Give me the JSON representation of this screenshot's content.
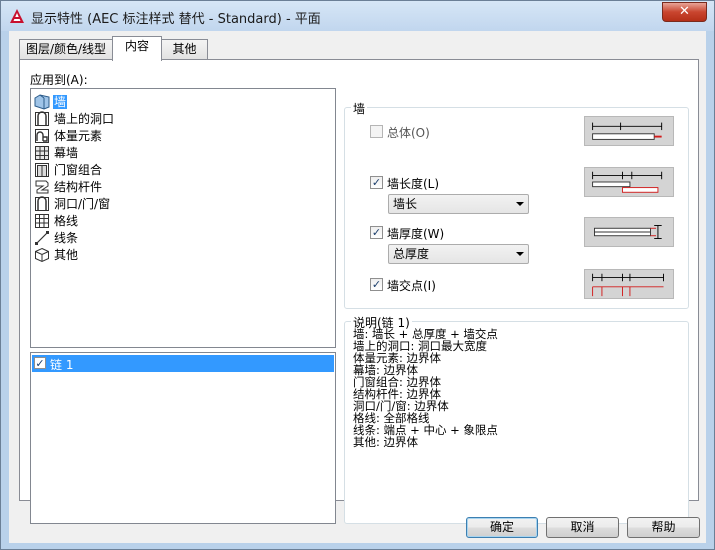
{
  "window": {
    "title": "显示特性 (AEC 标注样式 替代 - Standard) - 平面",
    "close_label": "✕"
  },
  "tabs": [
    {
      "label": "图层/颜色/线型",
      "active": false
    },
    {
      "label": "内容",
      "active": true
    },
    {
      "label": "其他",
      "active": false
    }
  ],
  "apply_to": {
    "label": "应用到(A):",
    "items": [
      {
        "label": "墙",
        "icon": "wall-icon",
        "selected": true
      },
      {
        "label": "墙上的洞口",
        "icon": "wall-opening-icon",
        "selected": false
      },
      {
        "label": "体量元素",
        "icon": "mass-element-icon",
        "selected": false
      },
      {
        "label": "幕墙",
        "icon": "curtain-wall-icon",
        "selected": false
      },
      {
        "label": "门窗组合",
        "icon": "door-window-assembly-icon",
        "selected": false
      },
      {
        "label": "结构杆件",
        "icon": "structural-member-icon",
        "selected": false
      },
      {
        "label": "洞口/门/窗",
        "icon": "opening-door-window-icon",
        "selected": false
      },
      {
        "label": "格线",
        "icon": "grid-icon",
        "selected": false
      },
      {
        "label": "线条",
        "icon": "line-icon",
        "selected": false
      },
      {
        "label": "其他",
        "icon": "other-cube-icon",
        "selected": false
      }
    ]
  },
  "chains": {
    "items": [
      {
        "label": "链 1",
        "checked": true,
        "selected": true
      }
    ]
  },
  "wall_group": {
    "title": "墙",
    "total_label": "总体(O)",
    "total_checked": false,
    "length_label": "墙长度(L)",
    "length_checked": true,
    "length_option": "墙长",
    "thickness_label": "墙厚度(W)",
    "thickness_checked": true,
    "thickness_option": "总厚度",
    "intersection_label": "墙交点(I)",
    "intersection_checked": true
  },
  "description": {
    "title": "说明(链 1)",
    "lines": "墙: 墙长 + 总厚度 + 墙交点\n墙上的洞口: 洞口最大宽度\n体量元素: 边界体\n幕墙: 边界体\n门窗组合: 边界体\n结构杆件: 边界体\n洞口/门/窗: 边界体\n格线: 全部格线\n线条: 端点 + 中心 + 象限点\n其他: 边界体"
  },
  "buttons": {
    "ok": "确定",
    "cancel": "取消",
    "help": "帮助"
  },
  "colors": {
    "selection": "#3399ff",
    "preview_red": "#d21a1a",
    "title_gradient": "#c1d6ee"
  }
}
